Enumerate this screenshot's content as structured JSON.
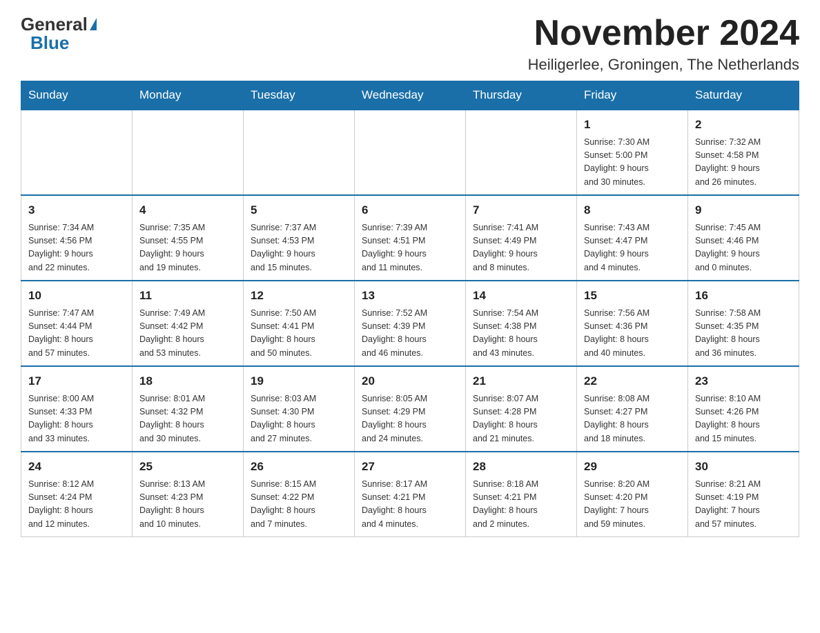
{
  "logo": {
    "general": "General",
    "blue": "Blue"
  },
  "title": {
    "month": "November 2024",
    "location": "Heiligerlee, Groningen, The Netherlands"
  },
  "weekdays": [
    "Sunday",
    "Monday",
    "Tuesday",
    "Wednesday",
    "Thursday",
    "Friday",
    "Saturday"
  ],
  "weeks": [
    [
      {
        "day": "",
        "info": ""
      },
      {
        "day": "",
        "info": ""
      },
      {
        "day": "",
        "info": ""
      },
      {
        "day": "",
        "info": ""
      },
      {
        "day": "",
        "info": ""
      },
      {
        "day": "1",
        "info": "Sunrise: 7:30 AM\nSunset: 5:00 PM\nDaylight: 9 hours\nand 30 minutes."
      },
      {
        "day": "2",
        "info": "Sunrise: 7:32 AM\nSunset: 4:58 PM\nDaylight: 9 hours\nand 26 minutes."
      }
    ],
    [
      {
        "day": "3",
        "info": "Sunrise: 7:34 AM\nSunset: 4:56 PM\nDaylight: 9 hours\nand 22 minutes."
      },
      {
        "day": "4",
        "info": "Sunrise: 7:35 AM\nSunset: 4:55 PM\nDaylight: 9 hours\nand 19 minutes."
      },
      {
        "day": "5",
        "info": "Sunrise: 7:37 AM\nSunset: 4:53 PM\nDaylight: 9 hours\nand 15 minutes."
      },
      {
        "day": "6",
        "info": "Sunrise: 7:39 AM\nSunset: 4:51 PM\nDaylight: 9 hours\nand 11 minutes."
      },
      {
        "day": "7",
        "info": "Sunrise: 7:41 AM\nSunset: 4:49 PM\nDaylight: 9 hours\nand 8 minutes."
      },
      {
        "day": "8",
        "info": "Sunrise: 7:43 AM\nSunset: 4:47 PM\nDaylight: 9 hours\nand 4 minutes."
      },
      {
        "day": "9",
        "info": "Sunrise: 7:45 AM\nSunset: 4:46 PM\nDaylight: 9 hours\nand 0 minutes."
      }
    ],
    [
      {
        "day": "10",
        "info": "Sunrise: 7:47 AM\nSunset: 4:44 PM\nDaylight: 8 hours\nand 57 minutes."
      },
      {
        "day": "11",
        "info": "Sunrise: 7:49 AM\nSunset: 4:42 PM\nDaylight: 8 hours\nand 53 minutes."
      },
      {
        "day": "12",
        "info": "Sunrise: 7:50 AM\nSunset: 4:41 PM\nDaylight: 8 hours\nand 50 minutes."
      },
      {
        "day": "13",
        "info": "Sunrise: 7:52 AM\nSunset: 4:39 PM\nDaylight: 8 hours\nand 46 minutes."
      },
      {
        "day": "14",
        "info": "Sunrise: 7:54 AM\nSunset: 4:38 PM\nDaylight: 8 hours\nand 43 minutes."
      },
      {
        "day": "15",
        "info": "Sunrise: 7:56 AM\nSunset: 4:36 PM\nDaylight: 8 hours\nand 40 minutes."
      },
      {
        "day": "16",
        "info": "Sunrise: 7:58 AM\nSunset: 4:35 PM\nDaylight: 8 hours\nand 36 minutes."
      }
    ],
    [
      {
        "day": "17",
        "info": "Sunrise: 8:00 AM\nSunset: 4:33 PM\nDaylight: 8 hours\nand 33 minutes."
      },
      {
        "day": "18",
        "info": "Sunrise: 8:01 AM\nSunset: 4:32 PM\nDaylight: 8 hours\nand 30 minutes."
      },
      {
        "day": "19",
        "info": "Sunrise: 8:03 AM\nSunset: 4:30 PM\nDaylight: 8 hours\nand 27 minutes."
      },
      {
        "day": "20",
        "info": "Sunrise: 8:05 AM\nSunset: 4:29 PM\nDaylight: 8 hours\nand 24 minutes."
      },
      {
        "day": "21",
        "info": "Sunrise: 8:07 AM\nSunset: 4:28 PM\nDaylight: 8 hours\nand 21 minutes."
      },
      {
        "day": "22",
        "info": "Sunrise: 8:08 AM\nSunset: 4:27 PM\nDaylight: 8 hours\nand 18 minutes."
      },
      {
        "day": "23",
        "info": "Sunrise: 8:10 AM\nSunset: 4:26 PM\nDaylight: 8 hours\nand 15 minutes."
      }
    ],
    [
      {
        "day": "24",
        "info": "Sunrise: 8:12 AM\nSunset: 4:24 PM\nDaylight: 8 hours\nand 12 minutes."
      },
      {
        "day": "25",
        "info": "Sunrise: 8:13 AM\nSunset: 4:23 PM\nDaylight: 8 hours\nand 10 minutes."
      },
      {
        "day": "26",
        "info": "Sunrise: 8:15 AM\nSunset: 4:22 PM\nDaylight: 8 hours\nand 7 minutes."
      },
      {
        "day": "27",
        "info": "Sunrise: 8:17 AM\nSunset: 4:21 PM\nDaylight: 8 hours\nand 4 minutes."
      },
      {
        "day": "28",
        "info": "Sunrise: 8:18 AM\nSunset: 4:21 PM\nDaylight: 8 hours\nand 2 minutes."
      },
      {
        "day": "29",
        "info": "Sunrise: 8:20 AM\nSunset: 4:20 PM\nDaylight: 7 hours\nand 59 minutes."
      },
      {
        "day": "30",
        "info": "Sunrise: 8:21 AM\nSunset: 4:19 PM\nDaylight: 7 hours\nand 57 minutes."
      }
    ]
  ]
}
